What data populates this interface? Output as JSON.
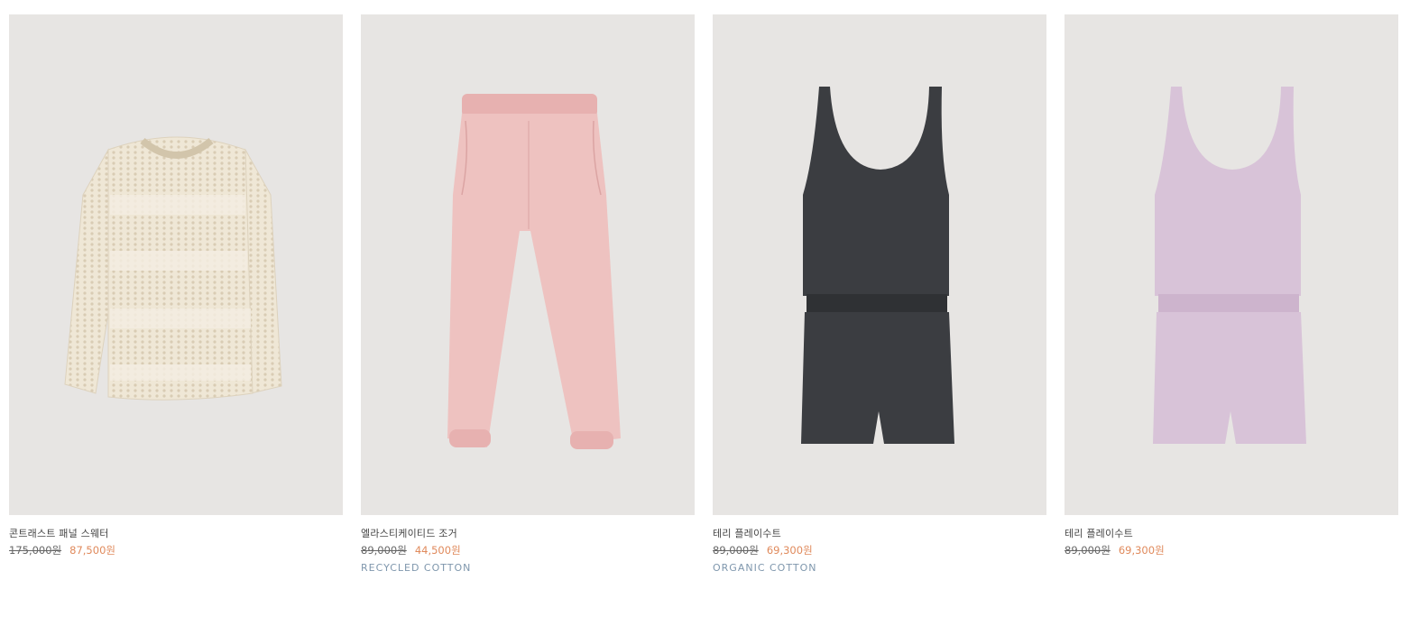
{
  "products": [
    {
      "title": "콘트래스트 패널 스웨터",
      "old_price": "175,000원",
      "new_price": "87,500원",
      "tag": "",
      "image": "cream-knit-sweater",
      "color": "#efe7d6"
    },
    {
      "title": "엘라스티케이티드 조거",
      "old_price": "89,000원",
      "new_price": "44,500원",
      "tag": "RECYCLED COTTON",
      "image": "pink-joggers",
      "color": "#eec2c0"
    },
    {
      "title": "테리 플레이수트",
      "old_price": "89,000원",
      "new_price": "69,300원",
      "tag": "ORGANIC COTTON",
      "image": "charcoal-terry-playsuit",
      "color": "#3b3d41"
    },
    {
      "title": "테리 플레이수트",
      "old_price": "89,000원",
      "new_price": "69,300원",
      "tag": "",
      "image": "lilac-terry-playsuit",
      "color": "#d8c3d8"
    }
  ],
  "colors": {
    "sale": "#e08a5c",
    "tag": "#7f97ad",
    "image_bg": "#e7e5e3"
  }
}
